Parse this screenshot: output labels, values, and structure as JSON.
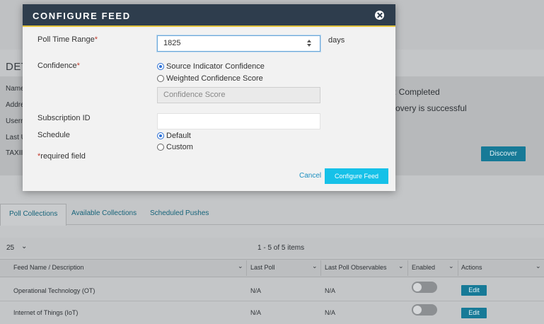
{
  "background": {
    "section_title": "DET",
    "field_labels": [
      "Name",
      "Addre",
      "Usern",
      "Last U",
      "TAXII"
    ],
    "status_lines": [
      ": Completed",
      "overy is successful"
    ],
    "discover_label": "Discover",
    "tabs": [
      {
        "label": "Poll Collections",
        "active": true
      },
      {
        "label": "Available Collections",
        "active": false
      },
      {
        "label": "Scheduled Pushes",
        "active": false
      }
    ],
    "pager": {
      "page_size": "25",
      "count_text": "1 - 5 of 5 items"
    },
    "table": {
      "headers": [
        "Feed Name / Description",
        "Last Poll",
        "Last Poll Observables",
        "Enabled",
        "Actions"
      ],
      "rows": [
        {
          "name": "Operational Technology (OT)",
          "last_poll": "N/A",
          "observables": "N/A",
          "enabled": false,
          "action": "Edit"
        },
        {
          "name": "Internet of Things (IoT)",
          "last_poll": "N/A",
          "observables": "N/A",
          "enabled": false,
          "action": "Edit"
        }
      ]
    }
  },
  "modal": {
    "title": "CONFIGURE FEED",
    "poll_time_range": {
      "label": "Poll Time Range",
      "value": "1825",
      "units": "days"
    },
    "confidence": {
      "label": "Confidence",
      "options": [
        {
          "label": "Source Indicator Confidence",
          "selected": true
        },
        {
          "label": "Weighted Confidence Score",
          "selected": false
        }
      ],
      "score_placeholder": "Confidence Score"
    },
    "subscription_id": {
      "label": "Subscription ID",
      "value": ""
    },
    "schedule": {
      "label": "Schedule",
      "options": [
        {
          "label": "Default",
          "selected": true
        },
        {
          "label": "Custom",
          "selected": false
        }
      ]
    },
    "required_note": "required field",
    "required_marker": "*",
    "cancel_label": "Cancel",
    "submit_label": "Configure Feed"
  },
  "colors": {
    "header_bg": "#2e3d4d",
    "header_accent": "#e3c23a",
    "primary": "#16c1e8",
    "link": "#1b8fc0",
    "required": "#c0392b"
  }
}
